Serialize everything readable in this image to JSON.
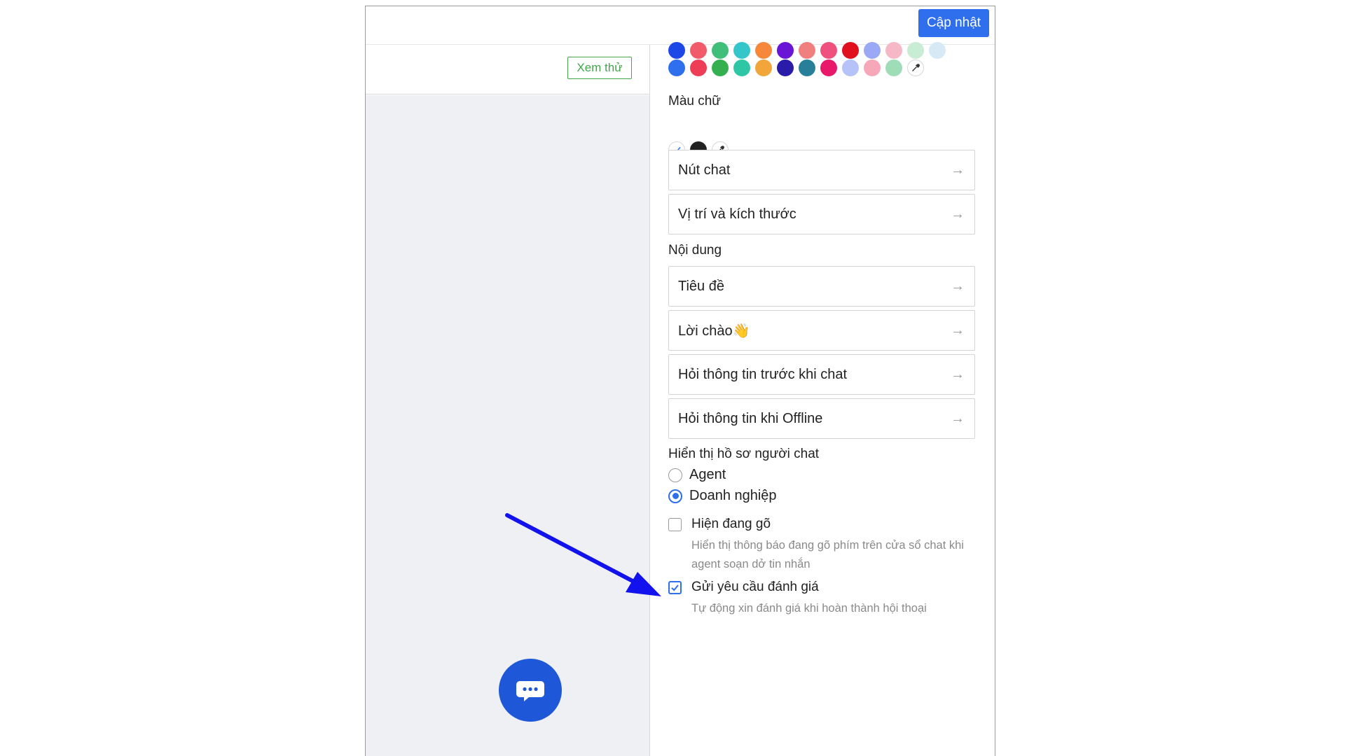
{
  "toolbar": {
    "update_label": "Cập nhật"
  },
  "preview": {
    "button_label": "Xem thử"
  },
  "colors": {
    "background_row1": [
      "#1e47e8",
      "#f05a6a",
      "#3fbf7a",
      "#34c6c9",
      "#f5883a",
      "#6a14d6",
      "#f07f7f",
      "#f0507e",
      "#e0101f",
      "#9aa8f5",
      "#f5b8c4",
      "#c8ecd4",
      "#d6eaf5"
    ],
    "background_row2": [
      "#2f6fed",
      "#ee3e57",
      "#35b051",
      "#2ec7a6",
      "#f2a53a",
      "#2a1ca8",
      "#277f99",
      "#e8186a",
      "#b6c3f8",
      "#f6a8b8",
      "#9fdcb8"
    ],
    "text_colors": [
      "#ffffff",
      "#222222"
    ],
    "accent": "#2f6fed",
    "preview_green": "#42a64a",
    "annotation_arrow": "#1212ee"
  },
  "text_color": {
    "title": "Màu chữ"
  },
  "nav": {
    "chat_button": "Nút chat",
    "position_size": "Vị trí và kích thước"
  },
  "content": {
    "title": "Nội dung",
    "items": [
      "Tiêu đề",
      "Lời chào👋",
      "Hỏi thông tin trước khi chat",
      "Hỏi thông tin khi Offline"
    ]
  },
  "profile": {
    "title": "Hiển thị hồ sơ người chat",
    "options": [
      "Agent",
      "Doanh nghiệp"
    ],
    "selected": "Doanh nghiệp"
  },
  "typing": {
    "label": "Hiện đang gõ",
    "description": "Hiển thị thông báo đang gõ phím trên cửa sổ chat khi agent soạn dở tin nhắn",
    "checked": false
  },
  "rating": {
    "label": "Gửi yêu cầu đánh giá",
    "description": "Tự động xin đánh giá khi hoàn thành hội thoại",
    "checked": true
  }
}
